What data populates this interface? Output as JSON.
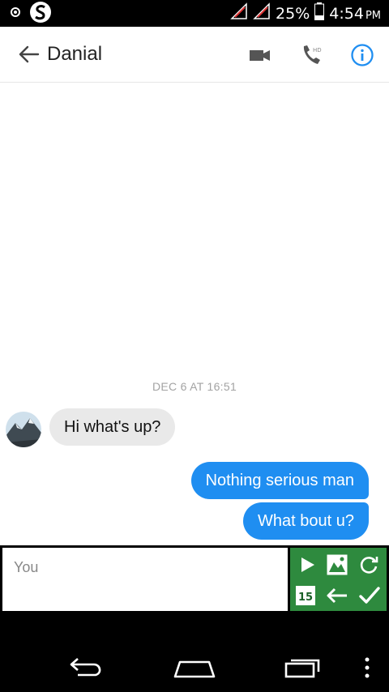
{
  "status_bar": {
    "battery_percent": "25%",
    "time": "4:54",
    "ampm": "PM"
  },
  "header": {
    "contact_name": "Danial",
    "back_icon": "arrow-left-icon",
    "video_icon": "video-camera-icon",
    "call_icon": "hd-phone-icon",
    "info_icon": "info-icon",
    "accent_color": "#1f8ef1"
  },
  "conversation": {
    "timestamp": "DEC 6 AT 16:51",
    "messages": [
      {
        "direction": "incoming",
        "text": "Hi what's up?"
      },
      {
        "direction": "outgoing",
        "text": "Nothing serious man"
      },
      {
        "direction": "outgoing",
        "text": "What bout u?"
      }
    ],
    "outgoing_color": "#1f8ef1",
    "incoming_color": "#e9e9e9"
  },
  "composer": {
    "placeholder": "You",
    "keyboard_panel_color": "#2e8a3e",
    "keyboard_badge": "15"
  }
}
